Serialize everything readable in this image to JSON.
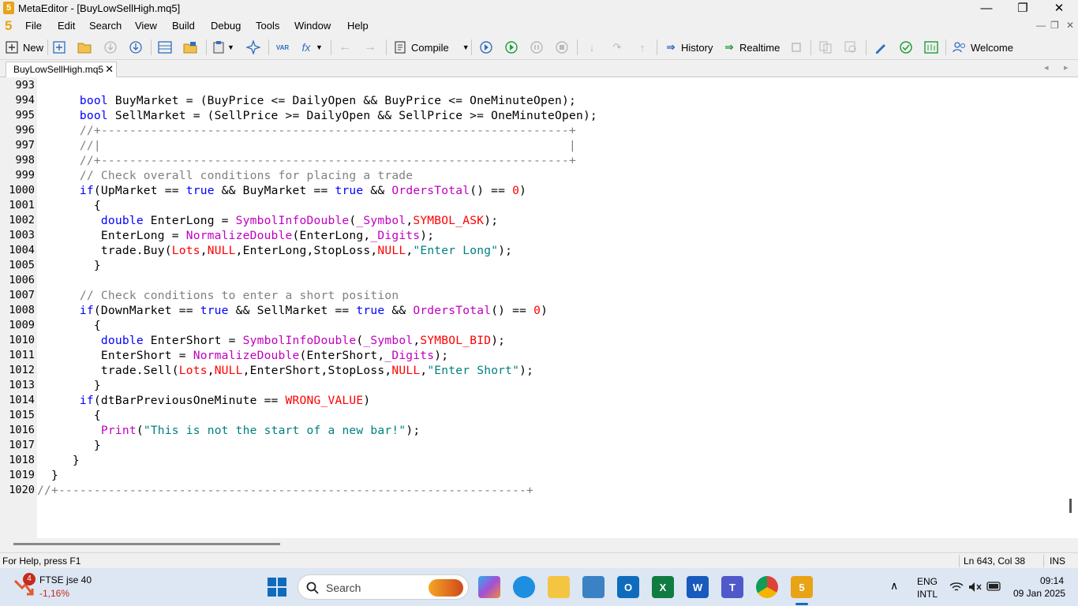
{
  "window": {
    "title": "MetaEditor - [BuyLowSellHigh.mq5]",
    "app_icon_glyph": "5",
    "minimize_glyph": "—",
    "maximize_glyph": "❐",
    "close_glyph": "✕"
  },
  "menu": {
    "logo": "5",
    "items": [
      "File",
      "Edit",
      "Search",
      "View",
      "Build",
      "Debug",
      "Tools",
      "Window",
      "Help"
    ],
    "mdi_controls": [
      "—",
      "❐",
      "✕"
    ]
  },
  "toolbar": {
    "new_label": "New",
    "compile_label": "Compile",
    "history_label": "History",
    "realtime_label": "Realtime",
    "welcome_label": "Welcome",
    "var_glyph": "VAR",
    "fx_glyph": "fx"
  },
  "tabs": {
    "active": "BuyLowSellHigh.mq5",
    "close_glyph": "✕",
    "nav": [
      "◂",
      "▸"
    ]
  },
  "editor": {
    "lines": [
      {
        "n": "993",
        "t": ""
      },
      {
        "n": "994",
        "t": "      bool BuyMarket = (BuyPrice <= DailyOpen && BuyPrice <= OneMinuteOpen);"
      },
      {
        "n": "995",
        "t": "      bool SellMarket = (SellPrice >= DailyOpen && SellPrice >= OneMinuteOpen);"
      },
      {
        "n": "996",
        "t": "      //+------------------------------------------------------------------+"
      },
      {
        "n": "997",
        "t": "      //|                                                                  |"
      },
      {
        "n": "998",
        "t": "      //+------------------------------------------------------------------+"
      },
      {
        "n": "999",
        "t": "      // Check overall conditions for placing a trade"
      },
      {
        "n": "1000",
        "t": "      if(UpMarket == true && BuyMarket == true && OrdersTotal() == 0)"
      },
      {
        "n": "1001",
        "t": "        {"
      },
      {
        "n": "1002",
        "t": "         double EnterLong = SymbolInfoDouble(_Symbol,SYMBOL_ASK);"
      },
      {
        "n": "1003",
        "t": "         EnterLong = NormalizeDouble(EnterLong,_Digits);"
      },
      {
        "n": "1004",
        "t": "         trade.Buy(Lots,NULL,EnterLong,StopLoss,NULL,\"Enter Long\");"
      },
      {
        "n": "1005",
        "t": "        }"
      },
      {
        "n": "1006",
        "t": ""
      },
      {
        "n": "1007",
        "t": "      // Check conditions to enter a short position"
      },
      {
        "n": "1008",
        "t": "      if(DownMarket == true && SellMarket == true && OrdersTotal() == 0)"
      },
      {
        "n": "1009",
        "t": "        {"
      },
      {
        "n": "1010",
        "t": "         double EnterShort = SymbolInfoDouble(_Symbol,SYMBOL_BID);"
      },
      {
        "n": "1011",
        "t": "         EnterShort = NormalizeDouble(EnterShort,_Digits);"
      },
      {
        "n": "1012",
        "t": "         trade.Sell(Lots,NULL,EnterShort,StopLoss,NULL,\"Enter Short\");"
      },
      {
        "n": "1013",
        "t": "        }"
      },
      {
        "n": "1014",
        "t": "      if(dtBarPreviousOneMinute == WRONG_VALUE)"
      },
      {
        "n": "1015",
        "t": "        {"
      },
      {
        "n": "1016",
        "t": "         Print(\"This is not the start of a new bar!\");"
      },
      {
        "n": "1017",
        "t": "        }"
      },
      {
        "n": "1018",
        "t": "     }"
      },
      {
        "n": "1019",
        "t": "  }"
      },
      {
        "n": "1020",
        "t": "//+------------------------------------------------------------------+"
      }
    ],
    "colors": {
      "keyword": "#0000ff",
      "function": "#c000c0",
      "macro": "#ff0000",
      "string": "#008080",
      "comment": "#808080"
    }
  },
  "status": {
    "help": "For Help, press F1",
    "position": "Ln 643, Col 38",
    "mode": "INS"
  },
  "taskbar": {
    "widget_badge": "4",
    "widget_title": "FTSE jse 40",
    "widget_value": "-1,16%",
    "search_placeholder": "Search",
    "lang_line1": "ENG",
    "lang_line2": "INTL",
    "time": "09:14",
    "date": "09 Jan 2025",
    "chevron": "∧",
    "app_icons": [
      "copilot-icon",
      "edge-icon",
      "file-explorer-icon",
      "remote-desktop-icon",
      "outlook-icon",
      "excel-icon",
      "word-icon",
      "teams-icon",
      "chrome-icon",
      "metaeditor-icon"
    ]
  }
}
